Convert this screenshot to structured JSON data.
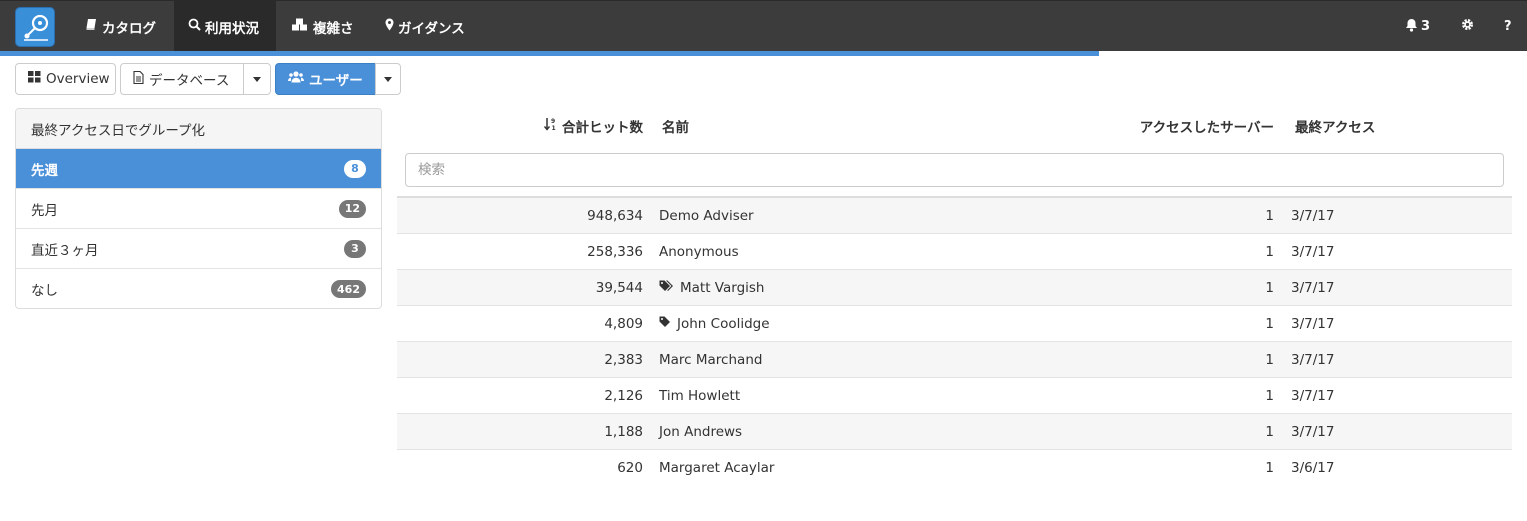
{
  "navbar": {
    "items": [
      {
        "label": "カタログ",
        "icon": "book-icon"
      },
      {
        "label": "利用状況",
        "icon": "search-icon",
        "active": true
      },
      {
        "label": "複雑さ",
        "icon": "cubes-icon"
      },
      {
        "label": "ガイダンス",
        "icon": "map-marker-icon"
      }
    ],
    "notifications_count": "3",
    "help_label": "?"
  },
  "progress": {
    "fraction": 0.72
  },
  "toolbar": {
    "overview_label": "Overview",
    "database_label": "データベース",
    "users_label": "ユーザー"
  },
  "grouping": {
    "title": "最終アクセス日でグループ化",
    "items": [
      {
        "label": "先週",
        "count": "8",
        "active": true
      },
      {
        "label": "先月",
        "count": "12"
      },
      {
        "label": "直近３ヶ月",
        "count": "3"
      },
      {
        "label": "なし",
        "count": "462"
      }
    ]
  },
  "table": {
    "headers": {
      "hits": "合計ヒット数",
      "name": "名前",
      "servers": "アクセスしたサーバー",
      "last_access": "最終アクセス"
    },
    "search_placeholder": "検索",
    "rows": [
      {
        "hits": "948,634",
        "name": "Demo Adviser",
        "tag": "",
        "servers": "1",
        "last_access": "3/7/17"
      },
      {
        "hits": "258,336",
        "name": "Anonymous",
        "tag": "",
        "servers": "1",
        "last_access": "3/7/17"
      },
      {
        "hits": "39,544",
        "name": "Matt Vargish",
        "tag": "tags-icon",
        "servers": "1",
        "last_access": "3/7/17"
      },
      {
        "hits": "4,809",
        "name": "John Coolidge",
        "tag": "tag-icon",
        "servers": "1",
        "last_access": "3/7/17"
      },
      {
        "hits": "2,383",
        "name": "Marc Marchand",
        "tag": "",
        "servers": "1",
        "last_access": "3/7/17"
      },
      {
        "hits": "2,126",
        "name": "Tim Howlett",
        "tag": "",
        "servers": "1",
        "last_access": "3/7/17"
      },
      {
        "hits": "1,188",
        "name": "Jon Andrews",
        "tag": "",
        "servers": "1",
        "last_access": "3/7/17"
      },
      {
        "hits": "620",
        "name": "Margaret Acaylar",
        "tag": "",
        "servers": "1",
        "last_access": "3/6/17"
      }
    ]
  },
  "colors": {
    "primary": "#4a90d9",
    "navbar": "#3c3c3c",
    "navbar_active": "#2a2a2a"
  }
}
